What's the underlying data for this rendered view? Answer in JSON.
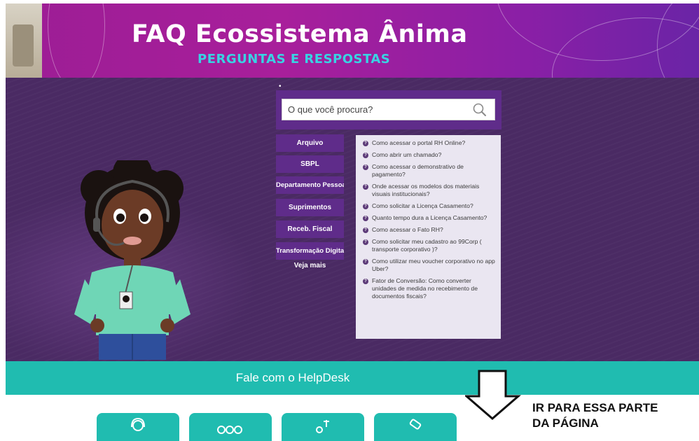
{
  "banner": {
    "title": "FAQ Ecossistema Ânima",
    "subtitle": "PERGUNTAS E RESPOSTAS"
  },
  "search": {
    "placeholder": "O que você procura?",
    "icon": "search-icon"
  },
  "categories": [
    "Arquivo",
    "SBPL",
    "Departamento Pessoal",
    "Suprimentos",
    "Receb. Fiscal",
    "Transformação Digital"
  ],
  "see_more": "Veja mais",
  "questions": [
    "Como acessar o portal RH Online?",
    "Como abrir um chamado?",
    "Como acessar o demonstrativo de pagamento?",
    "Onde acessar os modelos dos materiais visuais institucionais?",
    "Como solicitar a Licença Casamento?",
    "Quanto tempo dura a Licença Casamento?",
    "Como acessar o Fato RH?",
    "Como solicitar meu cadastro ao 99Corp ( transporte corporativo )?",
    "Como utilizar meu voucher corporativo no app Uber?",
    "Fator de Conversão: Como converter unidades de medida no recebimento de documentos fiscais?"
  ],
  "helpdesk": {
    "label": "Fale com o HelpDesk"
  },
  "annotation": {
    "line1": "IR PARA ESSA PARTE",
    "line2": "DA PÁGINA"
  },
  "colors": {
    "banner": "#a81f9b",
    "panel": "#4a2a63",
    "button": "#5f2c8a",
    "teal": "#20bcb0",
    "accent_text": "#39d3e3"
  },
  "tiles": [
    "headset-icon",
    "dots-icon",
    "tools-icon",
    "gavel-icon"
  ]
}
